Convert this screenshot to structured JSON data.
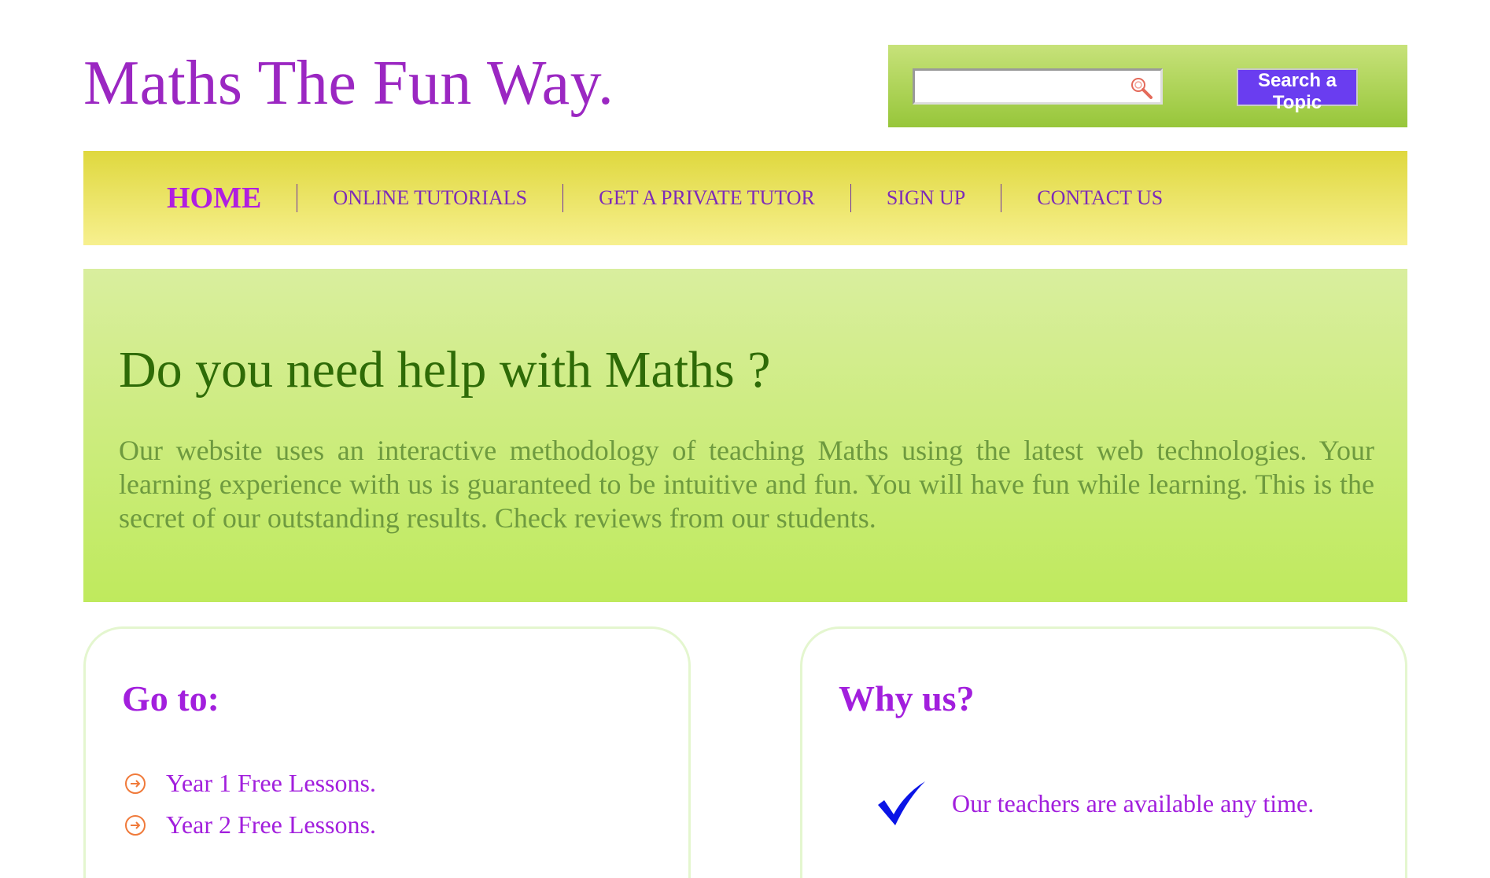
{
  "header": {
    "site_title": "Maths The Fun Way."
  },
  "search": {
    "value": "",
    "button_label": "Search a Topic",
    "icon": "search-icon"
  },
  "nav": {
    "items": [
      {
        "label": "HOME",
        "active": true
      },
      {
        "label": "ONLINE TUTORIALS",
        "active": false
      },
      {
        "label": "GET A PRIVATE TUTOR",
        "active": false
      },
      {
        "label": "SIGN UP",
        "active": false
      },
      {
        "label": "CONTACT US",
        "active": false
      }
    ]
  },
  "hero": {
    "heading": "Do you need help with Maths ?",
    "text": "Our website uses an interactive methodology of teaching Maths using the latest web technologies. Your learning experience with us is guaranteed to be intuitive and fun. You will have fun while learning. This is the secret of our outstanding results. Check reviews from our students."
  },
  "goto": {
    "title": "Go to:",
    "items": [
      {
        "label": "Year 1 Free Lessons."
      },
      {
        "label": "Year 2 Free Lessons."
      }
    ],
    "icon": "circle-arrow-right-icon"
  },
  "why": {
    "title": "Why us?",
    "items": [
      {
        "label": "Our teachers are available any time."
      }
    ],
    "icon": "checkmark-icon"
  },
  "colors": {
    "brand_purple": "#9b27c2",
    "nav_yellow": "#dfd83e",
    "hero_green": "#bfea5d",
    "search_green": "#97c63a",
    "button_violet": "#6a3df0"
  }
}
